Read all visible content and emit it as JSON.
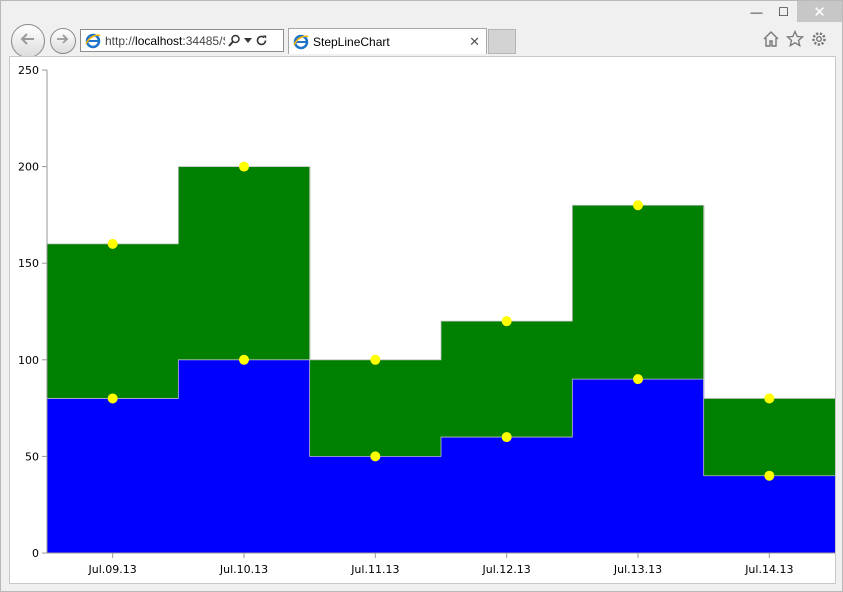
{
  "window": {
    "minimize_glyph": "—",
    "maximize_glyph": "☐",
    "close_glyph": "✕"
  },
  "address_bar": {
    "url_prefix": "http://",
    "url_host": "localhost",
    "url_rest": ":34485/S"
  },
  "tab": {
    "title": "StepLineChart",
    "close_glyph": "✕"
  },
  "icons": {
    "back": "back-arrow-icon",
    "forward": "forward-arrow-icon",
    "site": "ie-icon",
    "search": "search-icon",
    "dropdown": "chevron-down-icon",
    "refresh": "refresh-icon",
    "home": "home-icon",
    "favorites": "star-icon",
    "settings": "gear-icon"
  },
  "chart_data": {
    "type": "area",
    "subtype": "step-stacked",
    "categories": [
      "Jul.09.13",
      "Jul.10.13",
      "Jul.11.13",
      "Jul.12.13",
      "Jul.13.13",
      "Jul.14.13"
    ],
    "series": [
      {
        "values": [
          80,
          100,
          50,
          60,
          90,
          40
        ],
        "color": "#0000ff"
      },
      {
        "values": [
          80,
          100,
          50,
          60,
          90,
          40
        ],
        "color": "#008000"
      }
    ],
    "marker_color": "#ffff00",
    "ylim": [
      0,
      250
    ],
    "yticks": [
      "0",
      "50",
      "100",
      "150",
      "200",
      "250"
    ],
    "grid": false
  }
}
